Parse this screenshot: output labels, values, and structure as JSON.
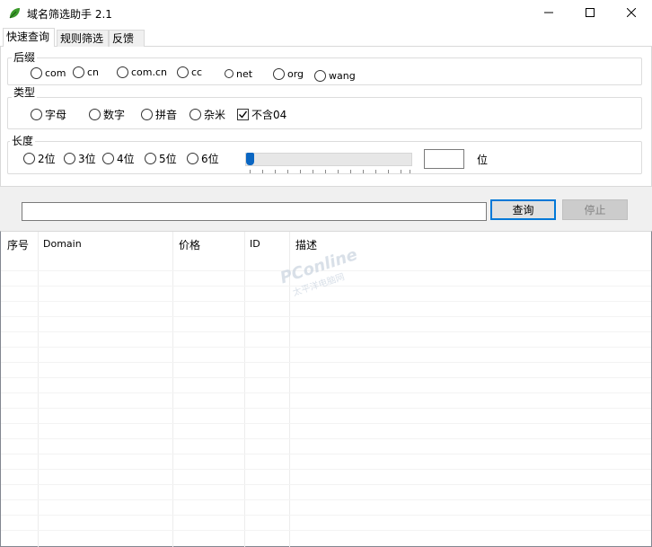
{
  "window": {
    "title": "域名筛选助手 2.1",
    "icon": "app-leaf-icon",
    "controls": [
      "minimize-icon",
      "maximize-icon",
      "close-icon"
    ]
  },
  "tabs": [
    {
      "label": "快速查询",
      "active": true
    },
    {
      "label": "规则筛选",
      "active": false
    },
    {
      "label": "反馈",
      "active": false
    }
  ],
  "suffix_group": {
    "label": "后缀",
    "options": [
      "com",
      "cn",
      "com.cn",
      "cc",
      "net",
      "org",
      "wang"
    ]
  },
  "type_group": {
    "label": "类型",
    "options": [
      "字母",
      "数字",
      "拼音",
      "杂米"
    ],
    "checkbox": {
      "label": "不含04",
      "checked": true
    }
  },
  "length_group": {
    "label": "长度",
    "options": [
      "2位",
      "3位",
      "4位",
      "5位",
      "6位"
    ],
    "slider_value": 0,
    "input_value": "",
    "unit": "位"
  },
  "query": {
    "input_value": "",
    "query_button": "查询",
    "stop_button": "停止"
  },
  "table": {
    "columns": [
      "序号",
      "Domain",
      "价格",
      "ID",
      "描述"
    ],
    "rows": []
  },
  "watermark": {
    "main": "PConline",
    "sub": "太平洋电脑网"
  },
  "colors": {
    "accent": "#0078d7",
    "slider_thumb": "#0a66c2",
    "disabled_text": "#838383"
  }
}
